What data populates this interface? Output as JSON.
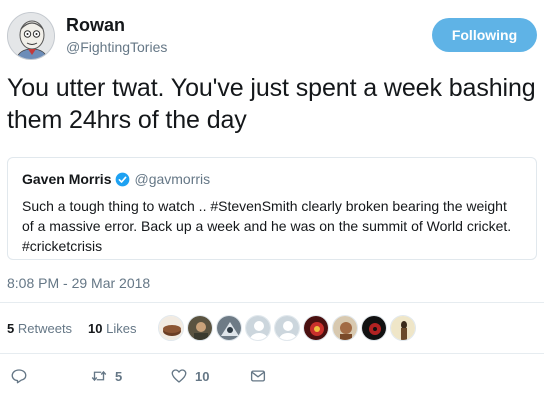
{
  "author": {
    "name": "Rowan",
    "handle": "@FightingTories",
    "follow_label": "Following"
  },
  "tweet_text": "You utter twat. You've just spent a week bashing them 24hrs of the day",
  "quoted": {
    "name": "Gaven Morris",
    "handle": "@gavmorris",
    "text": "Such a tough thing to watch .. #StevenSmith clearly broken bearing the weight of a massive error. Back up a week and he was on the summit of World cricket. #cricketcrisis"
  },
  "timestamp": "8:08 PM - 29 Mar 2018",
  "stats": {
    "retweets_count": "5",
    "retweets_label": "Retweets",
    "likes_count": "10",
    "likes_label": "Likes"
  },
  "actions": {
    "retweet_count": "5",
    "like_count": "10"
  },
  "colors": {
    "follow_button": "#5fb3e6",
    "verified": "#1da1f2",
    "secondary_text": "#657786"
  }
}
